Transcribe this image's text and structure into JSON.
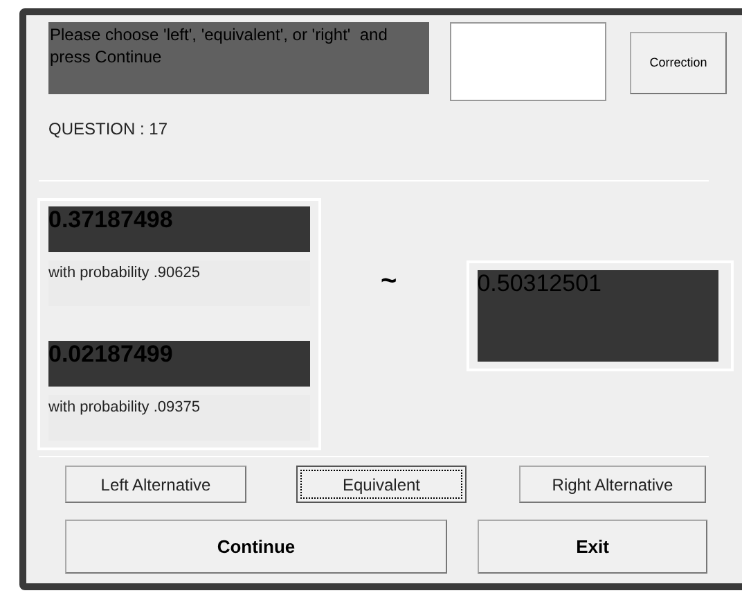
{
  "prompt": "Please choose 'left', 'equivalent', or 'right'  and press Continue",
  "correction_button": "Correction",
  "question": "QUESTION : 17",
  "left_alternative": [
    {
      "value": "0.37187498",
      "probability": "with probability  .90625"
    },
    {
      "value": "0.02187499",
      "probability": "with probability  .09375"
    }
  ],
  "relation": "~",
  "right_alternative": {
    "value": "0.50312501"
  },
  "choice_buttons": [
    {
      "label": "Left Alternative",
      "selected": false
    },
    {
      "label": "Equivalent",
      "selected": true
    },
    {
      "label": "Right Alternative",
      "selected": false
    }
  ],
  "action_buttons": [
    "Continue",
    "Exit"
  ]
}
